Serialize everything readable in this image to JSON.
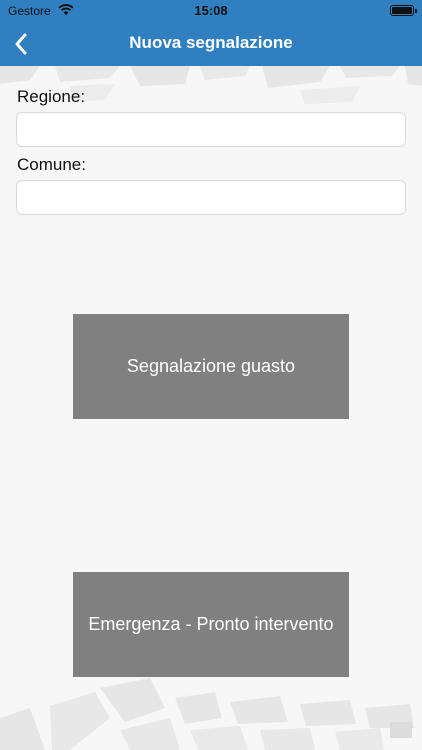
{
  "status_bar": {
    "carrier": "Gestore",
    "time": "15:08",
    "icons": [
      "wifi-icon",
      "battery-icon"
    ]
  },
  "nav": {
    "title": "Nuova segnalazione",
    "back_icon": "chevron-left-icon"
  },
  "form": {
    "regione_label": "Regione:",
    "regione_value": "",
    "comune_label": "Comune:",
    "comune_value": ""
  },
  "actions": {
    "guasto_label": "Segnalazione guasto",
    "emergenza_label": "Emergenza - Pronto intervento"
  },
  "colors": {
    "nav_background": "#2f7fc1",
    "button_background": "#808080",
    "page_background": "#f7f7f7"
  }
}
